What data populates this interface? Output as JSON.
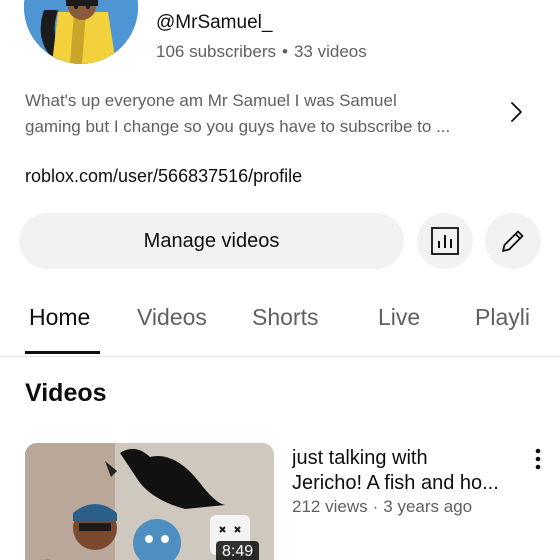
{
  "channel": {
    "handle": "@MrSamuel_",
    "subscribers": "106 subscribers",
    "separator": "•",
    "videos_count": "33 videos",
    "description_line1": "What's up everyone am Mr Samuel I was Samuel",
    "description_line2": "gaming but I change so you guys have to subscribe to ...",
    "link": "roblox.com/user/566837516/profile"
  },
  "actions": {
    "manage_label": "Manage videos",
    "analytics_icon": "analytics-icon",
    "edit_icon": "pencil-icon"
  },
  "tabs": [
    {
      "label": "Home",
      "active": true
    },
    {
      "label": "Videos",
      "active": false
    },
    {
      "label": "Shorts",
      "active": false
    },
    {
      "label": "Live",
      "active": false
    },
    {
      "label": "Playli",
      "active": false
    }
  ],
  "section": {
    "title": "Videos"
  },
  "videos": [
    {
      "title_line1": "just talking with",
      "title_line2": "Jericho! A fish and ho...",
      "views": "212 views",
      "separator": "·",
      "age": "3 years ago",
      "duration": "8:49"
    }
  ],
  "colors": {
    "text_primary": "#0f0f0f",
    "text_secondary": "#606060",
    "button_bg": "#f2f2f2",
    "avatar_bg": "#3a86c8"
  }
}
